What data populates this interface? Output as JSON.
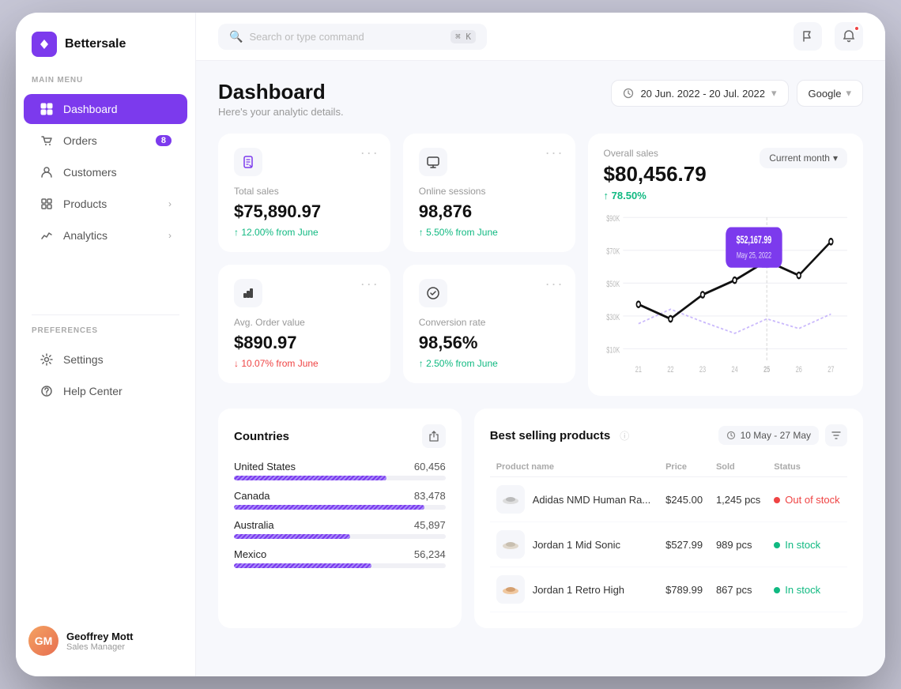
{
  "app": {
    "name": "Bettersale"
  },
  "header": {
    "search_placeholder": "Search or type command",
    "search_kbd": "⌘ K"
  },
  "sidebar": {
    "section_main": "MAIN MENU",
    "section_pref": "PREFERENCES",
    "items": [
      {
        "id": "dashboard",
        "label": "Dashboard",
        "active": true,
        "badge": null,
        "chevron": false
      },
      {
        "id": "orders",
        "label": "Orders",
        "active": false,
        "badge": "8",
        "chevron": false
      },
      {
        "id": "customers",
        "label": "Customers",
        "active": false,
        "badge": null,
        "chevron": false
      },
      {
        "id": "products",
        "label": "Products",
        "active": false,
        "badge": null,
        "chevron": true
      },
      {
        "id": "analytics",
        "label": "Analytics",
        "active": false,
        "badge": null,
        "chevron": true
      }
    ],
    "pref_items": [
      {
        "id": "settings",
        "label": "Settings"
      },
      {
        "id": "helpcenter",
        "label": "Help Center"
      }
    ],
    "user": {
      "name": "Geoffrey Mott",
      "role": "Sales Manager"
    }
  },
  "page": {
    "title": "Dashboard",
    "subtitle": "Here's your analytic details.",
    "date_range": "20 Jun. 2022 - 20 Jul. 2022",
    "source": "Google"
  },
  "metrics": {
    "total_sales": {
      "label": "Total sales",
      "value": "$75,890.97",
      "change": "12.00% from June",
      "change_dir": "up"
    },
    "online_sessions": {
      "label": "Online sessions",
      "value": "98,876",
      "change": "5.50% from June",
      "change_dir": "up"
    },
    "avg_order": {
      "label": "Avg. Order value",
      "value": "$890.97",
      "change": "10.07% from June",
      "change_dir": "down"
    },
    "conversion": {
      "label": "Conversion rate",
      "value": "98,56%",
      "change": "2.50% from June",
      "change_dir": "up"
    }
  },
  "sales_chart": {
    "label": "Overall sales",
    "value": "$80,456.79",
    "change": "78.50%",
    "period": "Current month",
    "tooltip_value": "$52,167.99",
    "tooltip_date": "May 25, 2022",
    "y_labels": [
      "$90K",
      "$70K",
      "$50K",
      "$30K",
      "$10K"
    ],
    "x_labels": [
      "21",
      "22",
      "23",
      "24",
      "25",
      "26",
      "27"
    ]
  },
  "countries": {
    "title": "Countries",
    "items": [
      {
        "name": "United States",
        "value": "60,456",
        "pct": 72
      },
      {
        "name": "Canada",
        "value": "83,478",
        "pct": 90
      },
      {
        "name": "Australia",
        "value": "45,897",
        "pct": 55
      },
      {
        "name": "Mexico",
        "value": "56,234",
        "pct": 65
      }
    ]
  },
  "products": {
    "title": "Best selling products",
    "date_range": "10 May - 27 May",
    "columns": [
      "Product name",
      "Price",
      "Sold",
      "Status"
    ],
    "rows": [
      {
        "name": "Adidas NMD Human Ra...",
        "price": "$245.00",
        "sold": "1,245 pcs",
        "status": "Out of stock",
        "in_stock": false
      },
      {
        "name": "Jordan 1 Mid Sonic",
        "price": "$527.99",
        "sold": "989 pcs",
        "status": "In stock",
        "in_stock": true
      },
      {
        "name": "Jordan 1 Retro High",
        "price": "$789.99",
        "sold": "867 pcs",
        "status": "In stock",
        "in_stock": true
      }
    ]
  }
}
